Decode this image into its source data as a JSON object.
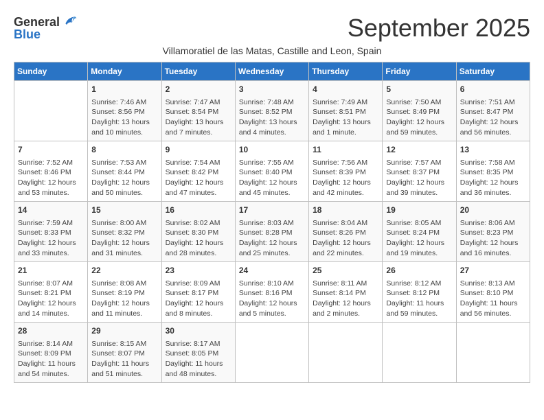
{
  "header": {
    "logo_line1": "General",
    "logo_line2": "Blue",
    "month_title": "September 2025",
    "subtitle": "Villamoratiel de las Matas, Castille and Leon, Spain"
  },
  "days_of_week": [
    "Sunday",
    "Monday",
    "Tuesday",
    "Wednesday",
    "Thursday",
    "Friday",
    "Saturday"
  ],
  "weeks": [
    [
      {
        "day": "",
        "text": ""
      },
      {
        "day": "1",
        "text": "Sunrise: 7:46 AM\nSunset: 8:56 PM\nDaylight: 13 hours\nand 10 minutes."
      },
      {
        "day": "2",
        "text": "Sunrise: 7:47 AM\nSunset: 8:54 PM\nDaylight: 13 hours\nand 7 minutes."
      },
      {
        "day": "3",
        "text": "Sunrise: 7:48 AM\nSunset: 8:52 PM\nDaylight: 13 hours\nand 4 minutes."
      },
      {
        "day": "4",
        "text": "Sunrise: 7:49 AM\nSunset: 8:51 PM\nDaylight: 13 hours\nand 1 minute."
      },
      {
        "day": "5",
        "text": "Sunrise: 7:50 AM\nSunset: 8:49 PM\nDaylight: 12 hours\nand 59 minutes."
      },
      {
        "day": "6",
        "text": "Sunrise: 7:51 AM\nSunset: 8:47 PM\nDaylight: 12 hours\nand 56 minutes."
      }
    ],
    [
      {
        "day": "7",
        "text": "Sunrise: 7:52 AM\nSunset: 8:46 PM\nDaylight: 12 hours\nand 53 minutes."
      },
      {
        "day": "8",
        "text": "Sunrise: 7:53 AM\nSunset: 8:44 PM\nDaylight: 12 hours\nand 50 minutes."
      },
      {
        "day": "9",
        "text": "Sunrise: 7:54 AM\nSunset: 8:42 PM\nDaylight: 12 hours\nand 47 minutes."
      },
      {
        "day": "10",
        "text": "Sunrise: 7:55 AM\nSunset: 8:40 PM\nDaylight: 12 hours\nand 45 minutes."
      },
      {
        "day": "11",
        "text": "Sunrise: 7:56 AM\nSunset: 8:39 PM\nDaylight: 12 hours\nand 42 minutes."
      },
      {
        "day": "12",
        "text": "Sunrise: 7:57 AM\nSunset: 8:37 PM\nDaylight: 12 hours\nand 39 minutes."
      },
      {
        "day": "13",
        "text": "Sunrise: 7:58 AM\nSunset: 8:35 PM\nDaylight: 12 hours\nand 36 minutes."
      }
    ],
    [
      {
        "day": "14",
        "text": "Sunrise: 7:59 AM\nSunset: 8:33 PM\nDaylight: 12 hours\nand 33 minutes."
      },
      {
        "day": "15",
        "text": "Sunrise: 8:00 AM\nSunset: 8:32 PM\nDaylight: 12 hours\nand 31 minutes."
      },
      {
        "day": "16",
        "text": "Sunrise: 8:02 AM\nSunset: 8:30 PM\nDaylight: 12 hours\nand 28 minutes."
      },
      {
        "day": "17",
        "text": "Sunrise: 8:03 AM\nSunset: 8:28 PM\nDaylight: 12 hours\nand 25 minutes."
      },
      {
        "day": "18",
        "text": "Sunrise: 8:04 AM\nSunset: 8:26 PM\nDaylight: 12 hours\nand 22 minutes."
      },
      {
        "day": "19",
        "text": "Sunrise: 8:05 AM\nSunset: 8:24 PM\nDaylight: 12 hours\nand 19 minutes."
      },
      {
        "day": "20",
        "text": "Sunrise: 8:06 AM\nSunset: 8:23 PM\nDaylight: 12 hours\nand 16 minutes."
      }
    ],
    [
      {
        "day": "21",
        "text": "Sunrise: 8:07 AM\nSunset: 8:21 PM\nDaylight: 12 hours\nand 14 minutes."
      },
      {
        "day": "22",
        "text": "Sunrise: 8:08 AM\nSunset: 8:19 PM\nDaylight: 12 hours\nand 11 minutes."
      },
      {
        "day": "23",
        "text": "Sunrise: 8:09 AM\nSunset: 8:17 PM\nDaylight: 12 hours\nand 8 minutes."
      },
      {
        "day": "24",
        "text": "Sunrise: 8:10 AM\nSunset: 8:16 PM\nDaylight: 12 hours\nand 5 minutes."
      },
      {
        "day": "25",
        "text": "Sunrise: 8:11 AM\nSunset: 8:14 PM\nDaylight: 12 hours\nand 2 minutes."
      },
      {
        "day": "26",
        "text": "Sunrise: 8:12 AM\nSunset: 8:12 PM\nDaylight: 11 hours\nand 59 minutes."
      },
      {
        "day": "27",
        "text": "Sunrise: 8:13 AM\nSunset: 8:10 PM\nDaylight: 11 hours\nand 56 minutes."
      }
    ],
    [
      {
        "day": "28",
        "text": "Sunrise: 8:14 AM\nSunset: 8:09 PM\nDaylight: 11 hours\nand 54 minutes."
      },
      {
        "day": "29",
        "text": "Sunrise: 8:15 AM\nSunset: 8:07 PM\nDaylight: 11 hours\nand 51 minutes."
      },
      {
        "day": "30",
        "text": "Sunrise: 8:17 AM\nSunset: 8:05 PM\nDaylight: 11 hours\nand 48 minutes."
      },
      {
        "day": "",
        "text": ""
      },
      {
        "day": "",
        "text": ""
      },
      {
        "day": "",
        "text": ""
      },
      {
        "day": "",
        "text": ""
      }
    ]
  ]
}
